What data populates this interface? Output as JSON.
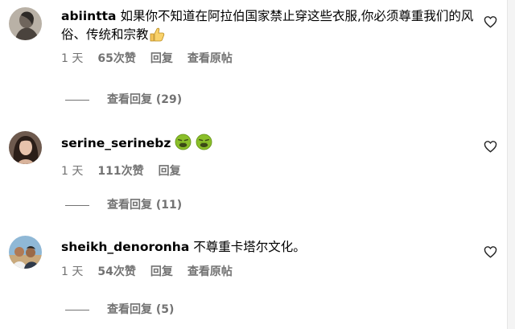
{
  "comments": [
    {
      "username": "abiintta",
      "text": "如果你不知道在阿拉伯国家禁止穿这些衣服,你必须尊重我们的风俗、传统和宗教",
      "emoji": "thumbs-up",
      "time": "1 天",
      "likes": "65次赞",
      "reply_label": "回复",
      "translate_label": "查看原帖",
      "view_replies": "查看回复 (29)"
    },
    {
      "username": "serine_serinebz",
      "text": "",
      "emoji": "nauseated-face x2",
      "time": "1 天",
      "likes": "111次赞",
      "reply_label": "回复",
      "view_replies": "查看回复 (11)"
    },
    {
      "username": "sheikh_denoronha",
      "text": "不尊重卡塔尔文化。",
      "time": "1 天",
      "likes": "54次赞",
      "reply_label": "回复",
      "translate_label": "查看原帖",
      "view_replies": "查看回复 (5)"
    }
  ],
  "colors": {
    "text": "#000000",
    "secondary": "#737373",
    "background": "#ffffff"
  }
}
